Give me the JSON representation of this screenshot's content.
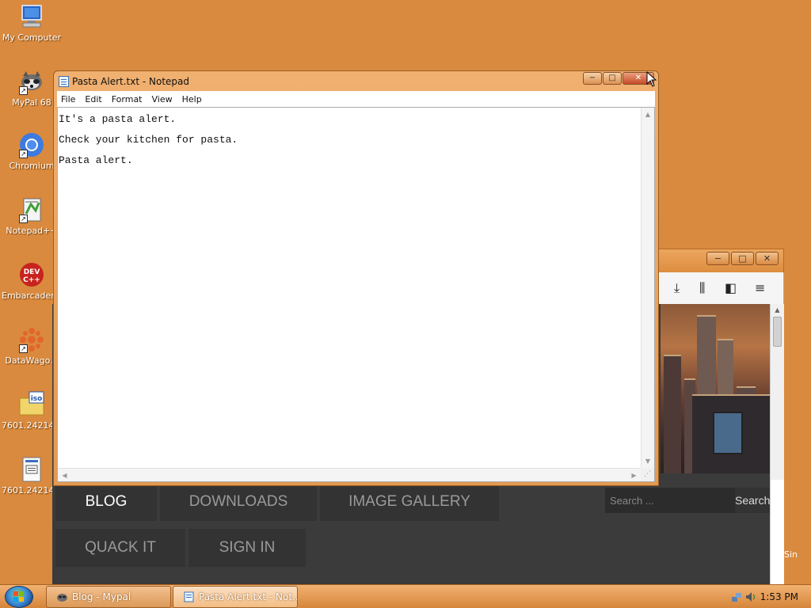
{
  "desktop": {
    "icons": [
      {
        "label": "My Computer",
        "icon": "computer-icon"
      },
      {
        "label": "MyPal 68",
        "icon": "raccoon-icon"
      },
      {
        "label": "Chromium",
        "icon": "chromium-icon"
      },
      {
        "label": "Notepad++",
        "icon": "notepadpp-icon"
      },
      {
        "label": "Embarcadero Dev-C++",
        "icon": "devcpp-icon",
        "badge": "DEV C++"
      },
      {
        "label": "DataWago...",
        "icon": "datawagon-icon"
      },
      {
        "label": "7601.24214...",
        "icon": "iso-file-icon",
        "badge": "iso"
      },
      {
        "label": "7601.24214...",
        "icon": "iso-document-icon"
      }
    ]
  },
  "notepad": {
    "title": "Pasta Alert.txt - Notepad",
    "buttons": {
      "minimize": "−",
      "maximize": "□",
      "close": "✕"
    },
    "menu": [
      "File",
      "Edit",
      "Format",
      "View",
      "Help"
    ],
    "content": "It's a pasta alert.\nCheck your kitchen for pasta.\nPasta alert."
  },
  "browser": {
    "window_buttons": {
      "minimize": "−",
      "maximize": "□",
      "close": "✕"
    },
    "toolbar_icons": [
      "download-icon",
      "library-icon",
      "sidebar-icon",
      "menu-icon"
    ],
    "toolbar_glyphs": {
      "download": "⤓",
      "library": "⫼",
      "sidebar": "◧",
      "menu": "≡"
    },
    "nav": [
      "BLOG",
      "DOWNLOADS",
      "IMAGE GALLERY",
      "QUACK IT",
      "SIGN IN"
    ],
    "active_nav": "BLOG",
    "search": {
      "placeholder": "Search ...",
      "button": "Search"
    },
    "side_text": "Sin"
  },
  "taskbar": {
    "tasks": [
      {
        "label": "Blog - Mypal",
        "icon": "mypal-icon"
      },
      {
        "label": "Pasta Alert.txt - Not...",
        "icon": "notepad-icon"
      }
    ],
    "clock": "1:53 PM"
  },
  "colors": {
    "desktop_bg": "#d98a3e",
    "window_frame": "#e39a52",
    "site_dark": "#3b3b3b"
  }
}
